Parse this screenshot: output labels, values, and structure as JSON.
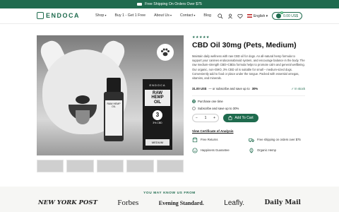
{
  "topbar": {
    "text": "Free Shipping On Orders Over $75",
    "icon": "truck-icon"
  },
  "brand": {
    "name": "ENDOCA"
  },
  "nav": {
    "items": [
      {
        "label": "Shop",
        "dropdown": true
      },
      {
        "label": "Buy 1 - Get 1 Free",
        "dropdown": false
      },
      {
        "label": "About Us",
        "dropdown": true
      },
      {
        "label": "Contact",
        "dropdown": true
      },
      {
        "label": "Blog",
        "dropdown": false
      }
    ],
    "language": "English",
    "cart_total": "0.00 US$",
    "cart_count": "0"
  },
  "product": {
    "rating_stars": "★★★★★",
    "title": "CBD Oil 30mg (Pets, Medium)",
    "description": "Maintain daily wellness with raw CBD oil for dogs. An all-natural hemp formula to support your canines endocannabinoid system, and encourage balance in the body. The raw medium-strength CBD+CBDa formula helps to promote calm and general wellbeing. Our organic, non-GMO, 3% CBD oil is suitable for small – medium-sized dogs. Conveniently add to food or place under the tongue. Packed with essential omegas, vitamins, and minerals.",
    "price": "31.00 US$",
    "price_note": "— or subscribe and save up to",
    "save_pct": "30%",
    "stock": "In stock",
    "options": [
      {
        "label": "Purchase one time",
        "selected": true
      },
      {
        "label": "Subscribe and save up to 30%",
        "selected": false
      }
    ],
    "quantity": "1",
    "add_to_cart": "Add To Cart",
    "certificate_link": "View Certificate of Analysis",
    "perks": [
      {
        "label": "Free Returns",
        "icon": "return-box-icon"
      },
      {
        "label": "Free shipping on orders over $75",
        "icon": "truck-icon"
      },
      {
        "label": "Happiness Guarantee",
        "icon": "smile-icon"
      },
      {
        "label": "Organic Hemp",
        "icon": "leaf-icon"
      }
    ]
  },
  "packaging": {
    "box_brand": "ENDOCA",
    "box_line1": "RAW",
    "box_line2": "HEMP",
    "box_line3": "OIL",
    "box_number": "3",
    "box_strength": "3% CBD",
    "box_size": "MEDIUM",
    "bottle_label": "RAW HEMP OIL"
  },
  "press": {
    "title": "YOU MAY KNOW US FROM",
    "logos": [
      "NEW YORK POST",
      "Forbes",
      "Evening Standard.",
      "Leafly.",
      "Daily Mail"
    ]
  },
  "colors": {
    "brand_green": "#1f6b4e",
    "accent_green": "#3fae6e"
  }
}
